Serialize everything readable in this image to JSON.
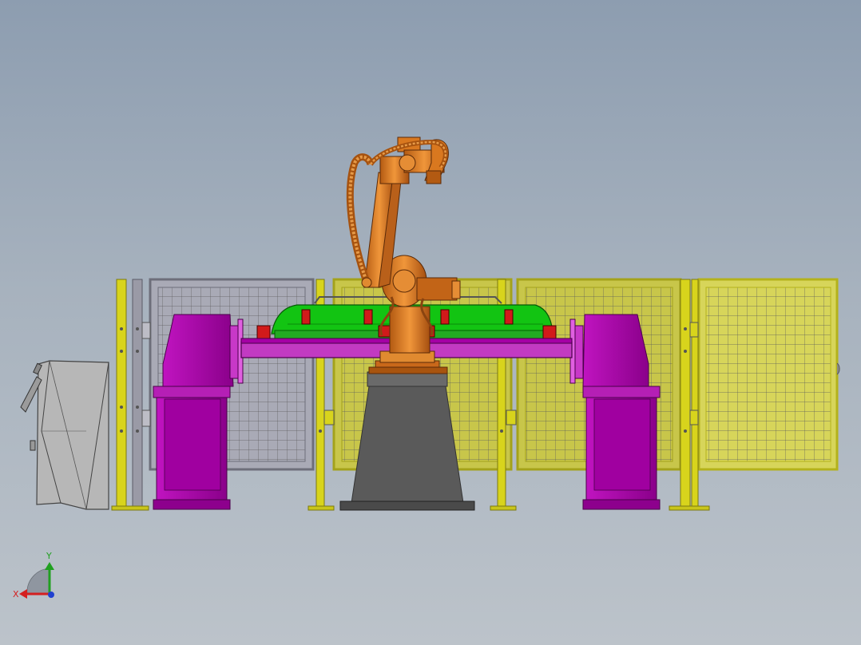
{
  "viewport": {
    "background_top": "#8d9db0",
    "background_bottom": "#bcc3ca"
  },
  "colors": {
    "positioner": "#a300a3",
    "positioner_dark": "#7a007a",
    "fixture": "#12c412",
    "fixture_dark": "#0b8a0b",
    "robot": "#d9781f",
    "robot_dark": "#8a4410",
    "pedestal": "#555555",
    "fence_yellow": "#d8d41c",
    "fence_gray": "#9a9aa6",
    "controller": "#b5b5b5",
    "clamp_red": "#d11a1a"
  },
  "triad": {
    "x_label": "X",
    "y_label": "Y",
    "x_color": "#d42020",
    "y_color": "#20a020",
    "z_color": "#2040d0"
  }
}
